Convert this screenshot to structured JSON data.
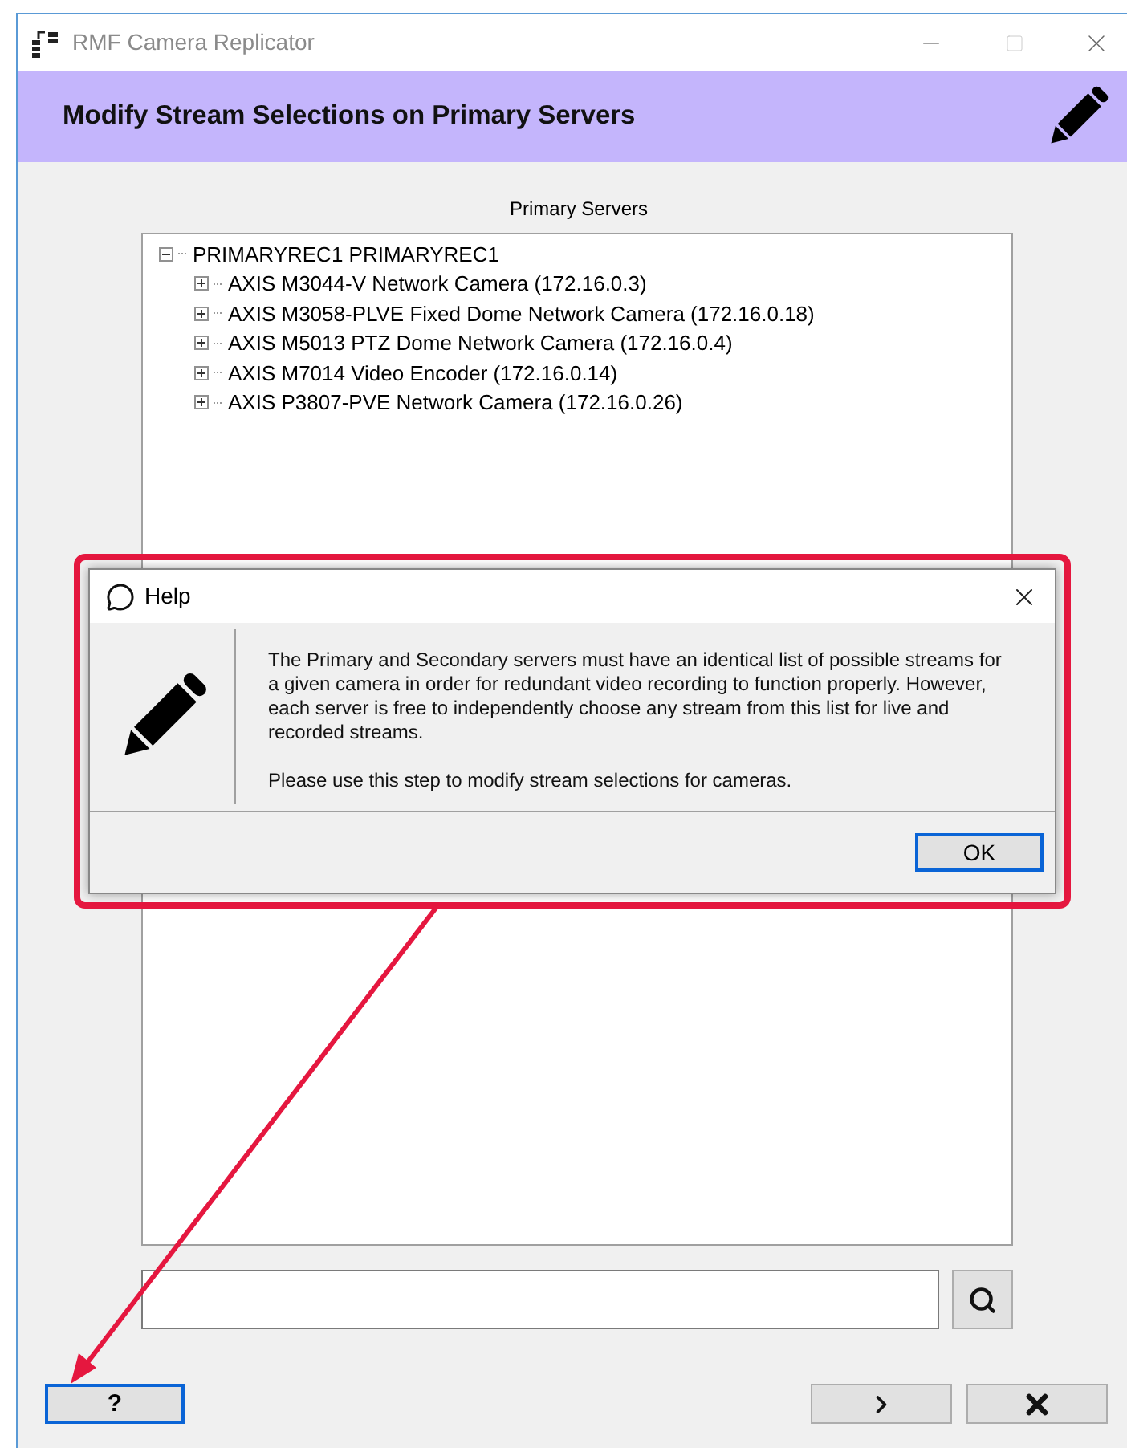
{
  "window": {
    "title": "RMF Camera Replicator"
  },
  "header": {
    "title": "Modify Stream Selections on Primary Servers"
  },
  "tree": {
    "label": "Primary Servers",
    "nodes": [
      {
        "label": "PRIMARYREC1 PRIMARYREC1",
        "expanded": true,
        "children": [
          {
            "label": "AXIS M3044-V Network Camera (172.16.0.3)",
            "expanded": false
          },
          {
            "label": "AXIS M3058-PLVE Fixed Dome Network Camera (172.16.0.18)",
            "expanded": false
          },
          {
            "label": "AXIS M5013 PTZ Dome Network Camera (172.16.0.4)",
            "expanded": false
          },
          {
            "label": "AXIS M7014 Video Encoder (172.16.0.14)",
            "expanded": false
          },
          {
            "label": "AXIS P3807-PVE Network Camera (172.16.0.26)",
            "expanded": false
          }
        ]
      }
    ]
  },
  "buttons": {
    "help": "?"
  },
  "help_dialog": {
    "title": "Help",
    "paragraphs": [
      "The Primary and Secondary servers must have an identical list of possible streams for a given camera in order for redundant video recording to function properly. However, each server is free to independently choose any stream from this list for live and recorded streams.",
      "Please use this step to modify stream selections for cameras."
    ],
    "ok": "OK"
  }
}
